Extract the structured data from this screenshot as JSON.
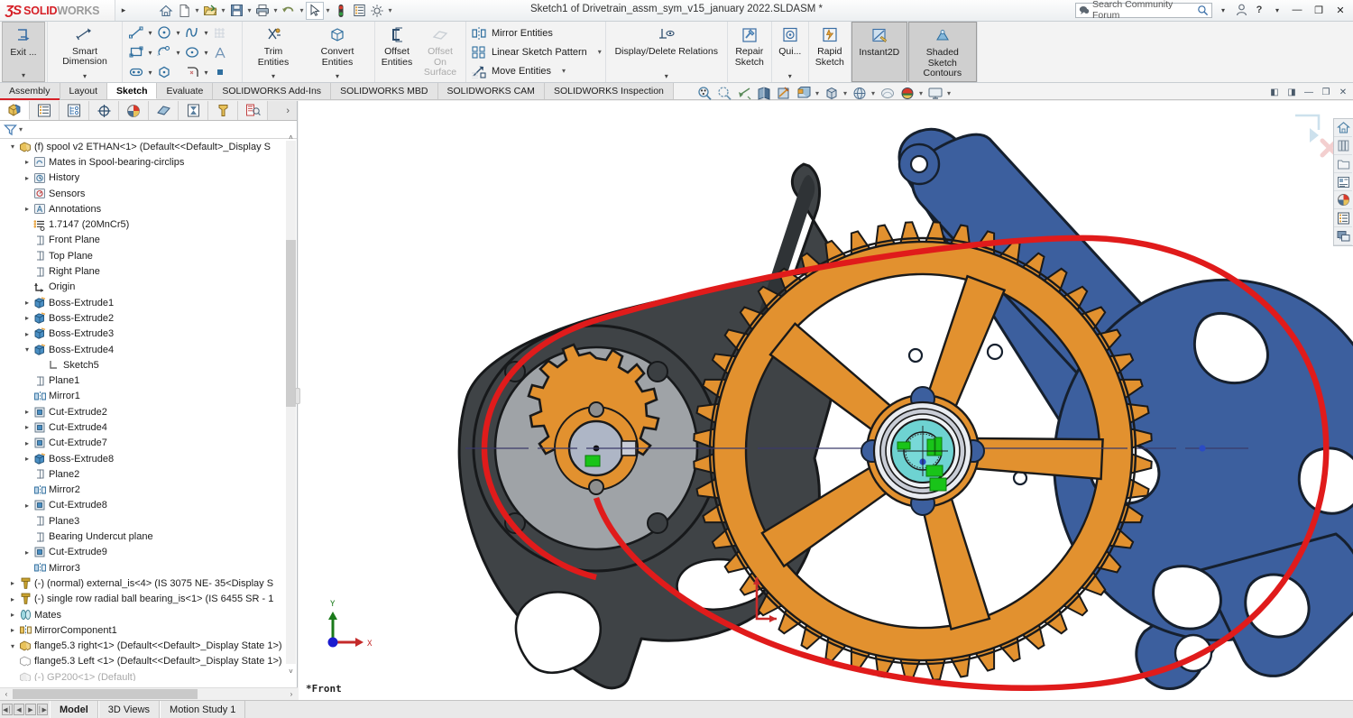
{
  "window": {
    "title": "Sketch1 of Drivetrain_assm_sym_v15_january 2022.SLDASM *",
    "brand_mark": "ƷS",
    "brand_solid": "SOLID",
    "brand_works": "WORKS",
    "accent_red": "#d61f26",
    "search_placeholder": "Search Community Forum",
    "minimize": "—",
    "restore": "❐",
    "close": "✕",
    "help": "?",
    "help_caret": "▾",
    "profile_icon": "user-icon"
  },
  "quick_access": [
    {
      "name": "home-icon",
      "label": "Home",
      "caret": false
    },
    {
      "name": "new-document-icon",
      "label": "New",
      "caret": true
    },
    {
      "name": "open-folder-icon",
      "label": "Open",
      "caret": true
    },
    {
      "name": "save-icon",
      "label": "Save",
      "caret": true
    },
    {
      "name": "print-icon",
      "label": "Print",
      "caret": true
    },
    {
      "name": "undo-icon",
      "label": "Undo",
      "caret": true
    },
    {
      "name": "select-cursor-icon",
      "label": "Select",
      "caret": true,
      "selected": true
    },
    {
      "name": "rebuild-icon",
      "label": "Rebuild",
      "caret": false
    },
    {
      "name": "file-properties-icon",
      "label": "File Properties",
      "caret": false
    },
    {
      "name": "gear-icon",
      "label": "Options",
      "caret": true
    }
  ],
  "ribbon": {
    "groups": [
      {
        "name": "exit-sketch",
        "type": "big",
        "items": [
          {
            "label": "Exit ...",
            "icon": "exit-sketch-icon",
            "selected": true,
            "caret": true
          }
        ]
      },
      {
        "name": "smart-dimension",
        "type": "big",
        "items": [
          {
            "label": "Smart Dimension",
            "icon": "smart-dimension-icon",
            "caret": true
          }
        ]
      },
      {
        "name": "sketch-entities",
        "type": "grid",
        "tools": [
          {
            "icon": "line-icon",
            "caret": true
          },
          {
            "icon": "circle-icon",
            "caret": true
          },
          {
            "icon": "spline-icon",
            "caret": true
          },
          {
            "icon": "grid-pattern-icon",
            "caret": false,
            "disabled": true
          },
          {
            "icon": "rectangle-icon",
            "caret": true
          },
          {
            "icon": "slot-icon",
            "caret": true
          },
          {
            "icon": "ellipse-icon",
            "caret": true
          },
          {
            "icon": "text-icon",
            "caret": false
          },
          {
            "icon": "centerline-icon",
            "caret": true
          },
          {
            "icon": "polygon-icon",
            "caret": false
          },
          {
            "icon": "fillet-icon",
            "caret": true
          },
          {
            "icon": "point-icon",
            "caret": false
          }
        ]
      },
      {
        "name": "trim-convert",
        "type": "med",
        "items": [
          {
            "label": "Trim Entities",
            "icon": "trim-entities-icon",
            "caret": true
          },
          {
            "label": "Convert Entities",
            "icon": "convert-entities-icon",
            "caret": true
          }
        ]
      },
      {
        "name": "offset",
        "type": "med",
        "items": [
          {
            "label": "Offset Entities",
            "icon": "offset-entities-icon",
            "caret": false
          },
          {
            "label": "Offset On Surface",
            "icon": "offset-on-surface-icon",
            "caret": false,
            "disabled": true
          }
        ]
      },
      {
        "name": "pattern-tools",
        "type": "list",
        "rows": [
          {
            "label": "Mirror Entities",
            "icon": "mirror-entities-icon",
            "caret": false
          },
          {
            "label": "Linear Sketch Pattern",
            "icon": "linear-sketch-pattern-icon",
            "caret": true
          },
          {
            "label": "Move Entities",
            "icon": "move-entities-icon",
            "caret": true
          }
        ]
      },
      {
        "name": "display-delete-relations",
        "type": "med",
        "items": [
          {
            "label": "Display/Delete Relations",
            "icon": "display-delete-relations-icon",
            "caret": true,
            "wide": true
          }
        ]
      },
      {
        "name": "repair-sketch",
        "type": "med",
        "items": [
          {
            "label": "Repair Sketch",
            "icon": "repair-sketch-icon",
            "caret": false
          }
        ]
      },
      {
        "name": "quick-snaps",
        "type": "med",
        "items": [
          {
            "label": "Qui...",
            "icon": "quick-snaps-icon",
            "caret": true
          }
        ]
      },
      {
        "name": "rapid-sketch",
        "type": "med",
        "items": [
          {
            "label": "Rapid Sketch",
            "icon": "rapid-sketch-icon",
            "caret": false
          }
        ]
      },
      {
        "name": "instant2d",
        "type": "med",
        "items": [
          {
            "label": "Instant2D",
            "icon": "instant2d-icon",
            "caret": false,
            "toggled": true
          }
        ]
      },
      {
        "name": "shaded-sketch-contours",
        "type": "med",
        "items": [
          {
            "label": "Shaded Sketch Contours",
            "icon": "shaded-sketch-contours-icon",
            "caret": false,
            "toggled": true
          }
        ]
      }
    ]
  },
  "command_tabs": [
    {
      "label": "Assembly",
      "active": false,
      "redline": true
    },
    {
      "label": "Layout",
      "active": false
    },
    {
      "label": "Sketch",
      "active": true
    },
    {
      "label": "Evaluate",
      "active": false
    },
    {
      "label": "SOLIDWORKS Add-Ins",
      "active": false
    },
    {
      "label": "SOLIDWORKS MBD",
      "active": false
    },
    {
      "label": "SOLIDWORKS CAM",
      "active": false
    },
    {
      "label": "SOLIDWORKS Inspection",
      "active": false
    }
  ],
  "view_toolbar": [
    {
      "name": "zoom-to-fit-icon",
      "caret": false
    },
    {
      "name": "zoom-to-area-icon",
      "caret": false
    },
    {
      "name": "previous-view-icon",
      "caret": false
    },
    {
      "name": "section-view-icon",
      "caret": false
    },
    {
      "name": "view-orientation-icon",
      "caret": false
    },
    {
      "name": "display-style-icon",
      "caret": true
    },
    {
      "name": "hide-show-items-icon",
      "caret": true
    },
    {
      "name": "edit-appearance-icon",
      "caret": true
    },
    {
      "name": "apply-scene-icon",
      "caret": true
    },
    {
      "name": "view-settings-icon",
      "caret": true
    }
  ],
  "viewport_window_buttons": [
    {
      "name": "restore-left-icon",
      "glyph": "◧"
    },
    {
      "name": "restore-right-icon",
      "glyph": "◨"
    },
    {
      "name": "minimize-view-icon",
      "glyph": "—"
    },
    {
      "name": "maximize-view-icon",
      "glyph": "❐"
    },
    {
      "name": "close-view-icon",
      "glyph": "✕"
    }
  ],
  "feature_manager": {
    "tabs": [
      {
        "name": "feature-tree-tab",
        "icon": "feature-tree-icon",
        "active": true
      },
      {
        "name": "property-manager-tab",
        "icon": "property-manager-icon",
        "active": false
      },
      {
        "name": "configuration-manager-tab",
        "icon": "configuration-manager-icon",
        "active": false
      },
      {
        "name": "dimxpert-manager-tab",
        "icon": "dimxpert-icon",
        "active": false
      },
      {
        "name": "display-manager-tab",
        "icon": "display-manager-icon",
        "active": false
      },
      {
        "name": "appearance-tab",
        "icon": "appearance-icon",
        "active": false
      },
      {
        "name": "simulation-tab",
        "icon": "simulation-icon",
        "active": false
      },
      {
        "name": "cam-tab",
        "icon": "cam-tool-icon",
        "active": false
      },
      {
        "name": "inspection-tab",
        "icon": "inspection-icon",
        "active": false
      }
    ],
    "more_glyph": "›",
    "filter_icon": "filter-funnel-icon",
    "filter_caret": "▾",
    "tree": [
      {
        "indent": 0,
        "expander": "▾",
        "icon": "assembly-part-icon",
        "label": "(f) spool v2 ETHAN<1>  (Default<<Default>_Display S"
      },
      {
        "indent": 1,
        "expander": "▸",
        "icon": "mates-folder-icon",
        "label": "Mates in Spool-bearing-circlips"
      },
      {
        "indent": 1,
        "expander": "▸",
        "icon": "history-icon",
        "label": "History"
      },
      {
        "indent": 1,
        "expander": "",
        "icon": "sensors-icon",
        "label": "Sensors"
      },
      {
        "indent": 1,
        "expander": "▸",
        "icon": "annotations-icon",
        "label": "Annotations"
      },
      {
        "indent": 1,
        "expander": "",
        "icon": "material-icon",
        "label": "1.7147 (20MnCr5)"
      },
      {
        "indent": 1,
        "expander": "",
        "icon": "plane-icon",
        "label": "Front Plane"
      },
      {
        "indent": 1,
        "expander": "",
        "icon": "plane-icon",
        "label": "Top Plane"
      },
      {
        "indent": 1,
        "expander": "",
        "icon": "plane-icon",
        "label": "Right Plane"
      },
      {
        "indent": 1,
        "expander": "",
        "icon": "origin-icon",
        "label": "Origin"
      },
      {
        "indent": 1,
        "expander": "▸",
        "icon": "boss-extrude-icon",
        "label": "Boss-Extrude1"
      },
      {
        "indent": 1,
        "expander": "▸",
        "icon": "boss-extrude-icon",
        "label": "Boss-Extrude2"
      },
      {
        "indent": 1,
        "expander": "▸",
        "icon": "boss-extrude-icon",
        "label": "Boss-Extrude3"
      },
      {
        "indent": 1,
        "expander": "▾",
        "icon": "boss-extrude-icon",
        "label": "Boss-Extrude4"
      },
      {
        "indent": 2,
        "expander": "",
        "icon": "sketch-icon",
        "label": "Sketch5"
      },
      {
        "indent": 1,
        "expander": "",
        "icon": "plane-icon",
        "label": "Plane1"
      },
      {
        "indent": 1,
        "expander": "",
        "icon": "mirror-icon",
        "label": "Mirror1"
      },
      {
        "indent": 1,
        "expander": "▸",
        "icon": "cut-extrude-icon",
        "label": "Cut-Extrude2"
      },
      {
        "indent": 1,
        "expander": "▸",
        "icon": "cut-extrude-icon",
        "label": "Cut-Extrude4"
      },
      {
        "indent": 1,
        "expander": "▸",
        "icon": "cut-extrude-icon",
        "label": "Cut-Extrude7"
      },
      {
        "indent": 1,
        "expander": "▸",
        "icon": "boss-extrude-icon",
        "label": "Boss-Extrude8"
      },
      {
        "indent": 1,
        "expander": "",
        "icon": "plane-icon",
        "label": "Plane2"
      },
      {
        "indent": 1,
        "expander": "",
        "icon": "mirror-icon",
        "label": "Mirror2"
      },
      {
        "indent": 1,
        "expander": "▸",
        "icon": "cut-extrude-icon",
        "label": "Cut-Extrude8"
      },
      {
        "indent": 1,
        "expander": "",
        "icon": "plane-icon",
        "label": "Plane3"
      },
      {
        "indent": 1,
        "expander": "",
        "icon": "plane-icon",
        "label": "Bearing Undercut plane"
      },
      {
        "indent": 1,
        "expander": "▸",
        "icon": "cut-extrude-icon",
        "label": "Cut-Extrude9"
      },
      {
        "indent": 1,
        "expander": "",
        "icon": "mirror-icon",
        "label": "Mirror3"
      },
      {
        "indent": 0,
        "expander": "▸",
        "icon": "fastener-icon",
        "label": "(-) (normal) external_is<4>  (IS 3075 NE- 35<Display S"
      },
      {
        "indent": 0,
        "expander": "▸",
        "icon": "fastener-icon",
        "label": "(-) single row radial ball bearing_is<1>  (IS 6455 SR - 1"
      },
      {
        "indent": 0,
        "expander": "▸",
        "icon": "mates-icon",
        "label": "Mates"
      },
      {
        "indent": 0,
        "expander": "▸",
        "icon": "mirror-component-icon",
        "label": "MirrorComponent1"
      },
      {
        "indent": 0,
        "expander": "▾",
        "icon": "assembly-part-icon",
        "label": "flange5.3 right<1>  (Default<<Default>_Display State 1>)"
      },
      {
        "indent": 0,
        "expander": "",
        "icon": "assembly-part-hidden-icon",
        "label": "flange5.3 Left <1>  (Default<<Default>_Display State 1>)"
      },
      {
        "indent": 0,
        "expander": "",
        "icon": "assembly-part-suppressed-icon",
        "label": "(-) GP200<1>  (Default)",
        "dim": true
      }
    ],
    "scroll_up": "˄",
    "scroll_down": "˅",
    "hscroll_left": "‹",
    "hscroll_right": "›"
  },
  "viewport": {
    "view_label": "*Front",
    "triad": {
      "x_label": "X",
      "y_label": "Y"
    },
    "colors": {
      "chain": "#e01b1b",
      "sprocket_orange": "#e2912f",
      "crank_blue": "#3c5f9e",
      "swingarm_dark": "#3c3f42",
      "hub_silver": "#c9cdd6",
      "bearing_teal": "#6ed3d2",
      "axis_line": "#3a3a6a"
    },
    "confirm_corner": {
      "accept_icon": "accept-sketch-icon",
      "cancel_icon": "cancel-sketch-icon"
    }
  },
  "task_pane": [
    {
      "name": "solidworks-resources-icon"
    },
    {
      "name": "design-library-icon"
    },
    {
      "name": "file-explorer-icon"
    },
    {
      "name": "view-palette-icon"
    },
    {
      "name": "appearances-scenes-icon"
    },
    {
      "name": "custom-properties-icon"
    },
    {
      "name": "solidworks-forum-icon"
    }
  ],
  "bottom": {
    "nav": [
      "◀│",
      "◀",
      "▶",
      "│▶"
    ],
    "tabs": [
      {
        "label": "Model",
        "active": true
      },
      {
        "label": "3D Views",
        "active": false
      },
      {
        "label": "Motion Study 1",
        "active": false
      }
    ]
  }
}
